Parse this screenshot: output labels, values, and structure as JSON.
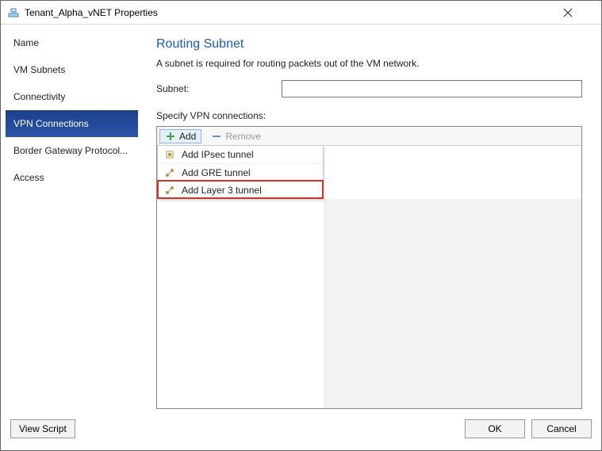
{
  "window": {
    "title": "Tenant_Alpha_vNET Properties"
  },
  "sidebar": {
    "items": [
      {
        "label": "Name"
      },
      {
        "label": "VM Subnets"
      },
      {
        "label": "Connectivity"
      },
      {
        "label": "VPN Connections"
      },
      {
        "label": "Border Gateway Protocol..."
      },
      {
        "label": "Access"
      }
    ],
    "selectedIndex": 3
  },
  "main": {
    "heading": "Routing Subnet",
    "description": "A subnet is required for routing packets out of the VM network.",
    "subnet_label": "Subnet:",
    "subnet_value": "",
    "vpn_label": "Specify VPN connections:",
    "toolbar": {
      "add_label": "Add",
      "remove_label": "Remove"
    },
    "add_menu": {
      "items": [
        {
          "label": "Add IPsec tunnel"
        },
        {
          "label": "Add GRE tunnel"
        },
        {
          "label": "Add Layer 3 tunnel"
        }
      ],
      "highlightIndex": 2
    }
  },
  "footer": {
    "view_script": "View Script",
    "ok": "OK",
    "cancel": "Cancel"
  }
}
